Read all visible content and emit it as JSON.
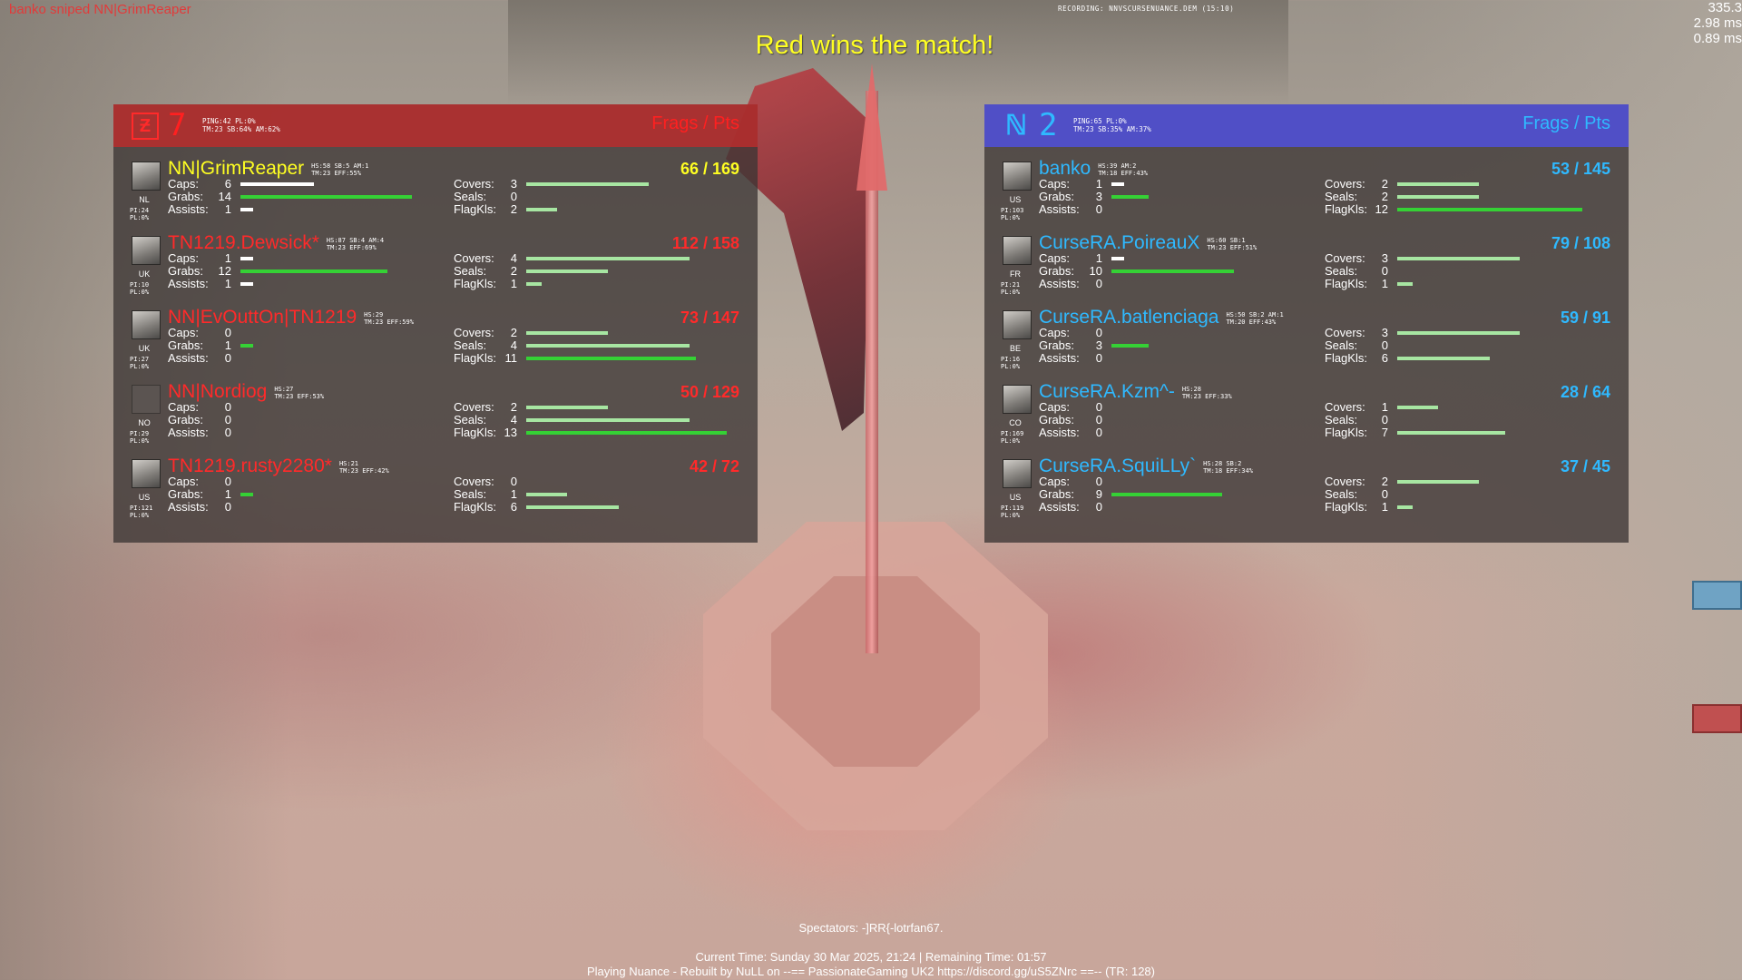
{
  "hud": {
    "killfeed": "banko sniped NN|GrimReaper",
    "recording": "RECORDING: NNVSCURSENUANCE.DEM (15:10)",
    "fps": "335.3",
    "frame_ms": "2.98 ms",
    "other_ms": "0.89 ms",
    "win_message": "Red wins the match!",
    "spectators": "Spectators: -]RR{-lotrfan67.",
    "current_time": "Current Time: Sunday 30 Mar 2025, 21:24 | Remaining Time: 01:57",
    "server_info": "Playing Nuance - Rebuilt by NuLL on --== PassionateGaming UK2 https://discord.gg/uS5ZNrc ==-- (TR: 128)"
  },
  "red_team": {
    "score": "7",
    "stats_line1": "PING:42 PL:0%",
    "stats_line2": "TM:23 SB:64% AM:62%",
    "header": "Frags / Pts",
    "color": "#ff2a2a",
    "players": [
      {
        "name": "NN|GrimReaper",
        "mini1": "HS:58 SB:5 AM:1",
        "mini2": "TM:23 EFF:55%",
        "score": "66 / 169",
        "pi": "PI:24\nPL:0%",
        "flag": "NL",
        "caps": "6",
        "grabs": "14",
        "assists": "1",
        "covers": "3",
        "seals": "0",
        "flagkls": "2"
      },
      {
        "name": "TN1219.Dewsick*",
        "mini1": "HS:87 SB:4 AM:4",
        "mini2": "TM:23 EFF:69%",
        "score": "112 / 158",
        "pi": "PI:10\nPL:0%",
        "flag": "UK",
        "caps": "1",
        "grabs": "12",
        "assists": "1",
        "covers": "4",
        "seals": "2",
        "flagkls": "1"
      },
      {
        "name": "NN|EvOuttOn|TN1219",
        "mini1": "HS:29",
        "mini2": "TM:23 EFF:59%",
        "score": "73 / 147",
        "pi": "PI:27\nPL:0%",
        "flag": "UK",
        "caps": "0",
        "grabs": "1",
        "assists": "0",
        "covers": "2",
        "seals": "4",
        "flagkls": "11"
      },
      {
        "name": "NN|Nordiog",
        "mini1": "HS:27",
        "mini2": "TM:23 EFF:53%",
        "score": "50 / 129",
        "pi": "PI:29\nPL:0%",
        "flag": "NO",
        "caps": "0",
        "grabs": "0",
        "assists": "0",
        "covers": "2",
        "seals": "4",
        "flagkls": "13"
      },
      {
        "name": "TN1219.rusty2280*",
        "mini1": "HS:21",
        "mini2": "TM:23 EFF:42%",
        "score": "42 / 72",
        "pi": "PI:121\nPL:0%",
        "flag": "US",
        "caps": "0",
        "grabs": "1",
        "assists": "0",
        "covers": "0",
        "seals": "1",
        "flagkls": "6"
      }
    ]
  },
  "blue_team": {
    "score": "2",
    "stats_line1": "PING:65 PL:0%",
    "stats_line2": "TM:23 SB:35% AM:37%",
    "header": "Frags / Pts",
    "color": "#2fb9ff",
    "players": [
      {
        "name": "banko",
        "mini1": "HS:39 AM:2",
        "mini2": "TM:18 EFF:43%",
        "score": "53 / 145",
        "pi": "PI:103\nPL:0%",
        "flag": "US",
        "caps": "1",
        "grabs": "3",
        "assists": "0",
        "covers": "2",
        "seals": "2",
        "flagkls": "12"
      },
      {
        "name": "CurseRA.PoireauX",
        "mini1": "HS:60 SB:1",
        "mini2": "TM:23 EFF:51%",
        "score": "79 / 108",
        "pi": "PI:21\nPL:0%",
        "flag": "FR",
        "caps": "1",
        "grabs": "10",
        "assists": "0",
        "covers": "3",
        "seals": "0",
        "flagkls": "1"
      },
      {
        "name": "CurseRA.batlenciaga",
        "mini1": "HS:50 SB:2 AM:1",
        "mini2": "TM:20 EFF:43%",
        "score": "59 / 91",
        "pi": "PI:16\nPL:0%",
        "flag": "BE",
        "caps": "0",
        "grabs": "3",
        "assists": "0",
        "covers": "3",
        "seals": "0",
        "flagkls": "6"
      },
      {
        "name": "CurseRA.Kzm^-",
        "mini1": "HS:28",
        "mini2": "TM:23 EFF:33%",
        "score": "28 / 64",
        "pi": "PI:169\nPL:0%",
        "flag": "CO",
        "caps": "0",
        "grabs": "0",
        "assists": "0",
        "covers": "1",
        "seals": "0",
        "flagkls": "7"
      },
      {
        "name": "CurseRA.SquiLLy`",
        "mini1": "HS:28 SB:2",
        "mini2": "TM:18 EFF:34%",
        "score": "37 / 45",
        "pi": "PI:119\nPL:0%",
        "flag": "US",
        "caps": "0",
        "grabs": "9",
        "assists": "0",
        "covers": "2",
        "seals": "0",
        "flagkls": "1"
      }
    ]
  },
  "labels": {
    "caps": "Caps:",
    "grabs": "Grabs:",
    "assists": "Assists:",
    "covers": "Covers:",
    "seals": "Seals:",
    "flagkls": "FlagKls:"
  }
}
